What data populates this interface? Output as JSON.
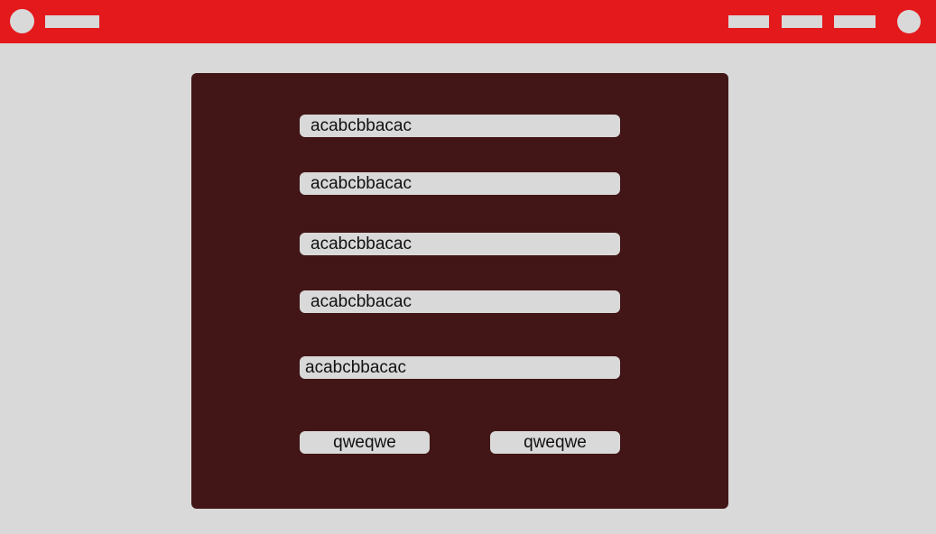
{
  "header": {
    "logo_icon": "circle-logo-icon",
    "brand_placeholder": "",
    "nav_items": [
      "",
      "",
      ""
    ],
    "avatar_icon": "circle-avatar-icon"
  },
  "form": {
    "fields": [
      {
        "value": "acabcbbacac"
      },
      {
        "value": "acabcbbacac"
      },
      {
        "value": "acabcbbacac"
      },
      {
        "value": "acabcbbacac"
      },
      {
        "value": "acabcbbacac"
      }
    ],
    "buttons": [
      {
        "label": "qweqwe"
      },
      {
        "label": "qweqwe"
      }
    ]
  },
  "colors": {
    "header": "#e3191b",
    "background": "#d9d9d9",
    "panel": "#421616"
  }
}
